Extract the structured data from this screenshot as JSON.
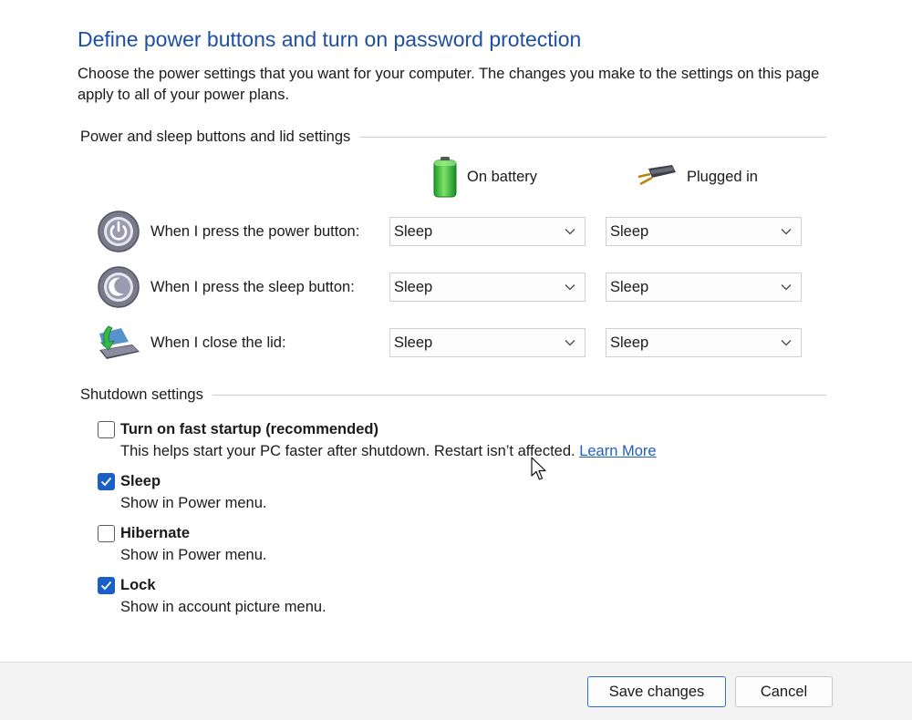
{
  "page": {
    "title": "Define power buttons and turn on password protection",
    "intro": "Choose the power settings that you want for your computer. The changes you make to the settings on this page apply to all of your power plans."
  },
  "power_section": {
    "header": "Power and sleep buttons and lid settings",
    "columns": [
      {
        "label": "On battery",
        "icon": "battery-icon"
      },
      {
        "label": "Plugged in",
        "icon": "plug-icon"
      }
    ],
    "rows": [
      {
        "label": "When I press the power button:",
        "icon": "power-button-icon",
        "on_battery": "Sleep",
        "plugged_in": "Sleep"
      },
      {
        "label": "When I press the sleep button:",
        "icon": "sleep-button-icon",
        "on_battery": "Sleep",
        "plugged_in": "Sleep"
      },
      {
        "label": "When I close the lid:",
        "icon": "laptop-lid-icon",
        "on_battery": "Sleep",
        "plugged_in": "Sleep"
      }
    ]
  },
  "shutdown_section": {
    "header": "Shutdown settings",
    "items": [
      {
        "label": "Turn on fast startup (recommended)",
        "checked": false,
        "desc": "This helps start your PC faster after shutdown. Restart isn’t affected.",
        "link": "Learn More"
      },
      {
        "label": "Sleep",
        "checked": true,
        "desc": "Show in Power menu."
      },
      {
        "label": "Hibernate",
        "checked": false,
        "desc": "Show in Power menu."
      },
      {
        "label": "Lock",
        "checked": true,
        "desc": "Show in account picture menu."
      }
    ]
  },
  "footer": {
    "save_label": "Save changes",
    "cancel_label": "Cancel"
  },
  "colors": {
    "title": "#1f4fa3",
    "link": "#1f5fbf",
    "checkbox_checked": "#1a5fc8",
    "footer_bg": "#f3f3f3"
  }
}
